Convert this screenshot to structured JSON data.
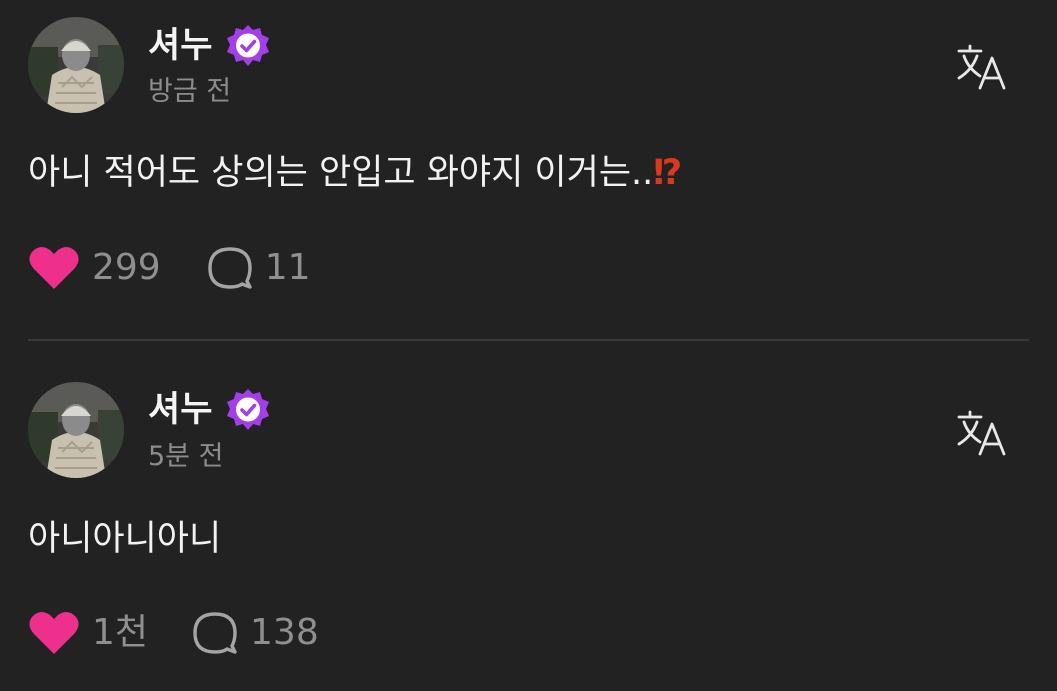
{
  "posts": [
    {
      "username": "셔누",
      "timestamp": "방금 전",
      "text": "아니 적어도 상의는 안입고 와야지 이거는..",
      "emoji": "⁉",
      "likes": "299",
      "replies": "11"
    },
    {
      "username": "셔누",
      "timestamp": "5분 전",
      "text": "아니아니아니",
      "likes": "1천",
      "replies": "138"
    }
  ],
  "colors": {
    "background": "#232223",
    "heart": "#ee2f8c",
    "badge": "#a33ee8",
    "emoji": "#d9391f",
    "muted_text": "#8c8c8c"
  },
  "icons": {
    "verified": "verified-badge-icon",
    "translate": "translate-icon",
    "like": "heart-icon",
    "reply": "speech-bubble-icon"
  }
}
